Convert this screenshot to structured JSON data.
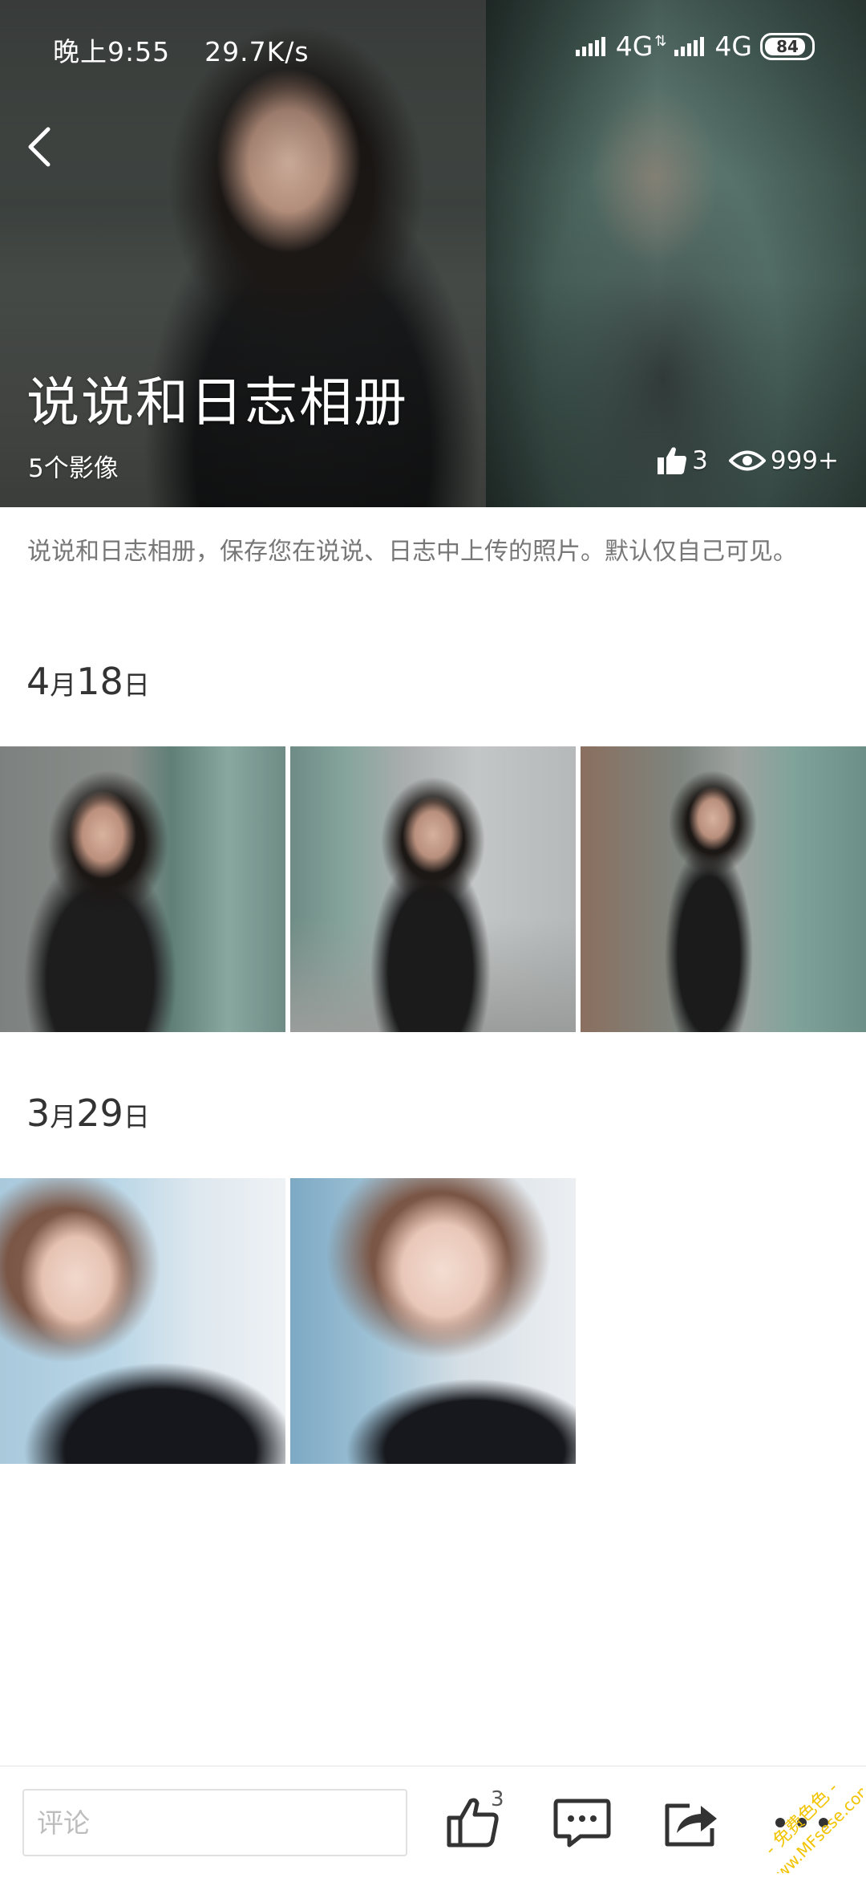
{
  "status_bar": {
    "time": "晚上9:55",
    "speed": "29.7K/s",
    "network_1": "4G",
    "network_2": "4G",
    "battery": "84"
  },
  "album": {
    "title": "说说和日志相册",
    "count_text": "5个影像",
    "likes": "3",
    "views": "999+",
    "description": "说说和日志相册，保存您在说说、日志中上传的照片。默认仅自己可见。"
  },
  "groups": [
    {
      "date_month": "4",
      "date_month_unit": "月",
      "date_day": "18",
      "date_day_unit": "日",
      "photo_count": 3
    },
    {
      "date_month": "3",
      "date_month_unit": "月",
      "date_day": "29",
      "date_day_unit": "日",
      "photo_count": 2
    }
  ],
  "bottom_bar": {
    "comment_placeholder": "评论",
    "like_count": "3"
  },
  "watermark": {
    "line1": "- 免费色色 -",
    "line2": "www.MFsese.com"
  },
  "icons": {
    "back": "back-arrow-icon",
    "thumb_up": "thumb-up-icon",
    "views": "eye-icon",
    "comment": "comment-icon",
    "share": "share-icon",
    "more": "more-icon"
  },
  "colors": {
    "watermark": "#f2c400",
    "text_muted": "#777777",
    "icon": "#333333"
  }
}
